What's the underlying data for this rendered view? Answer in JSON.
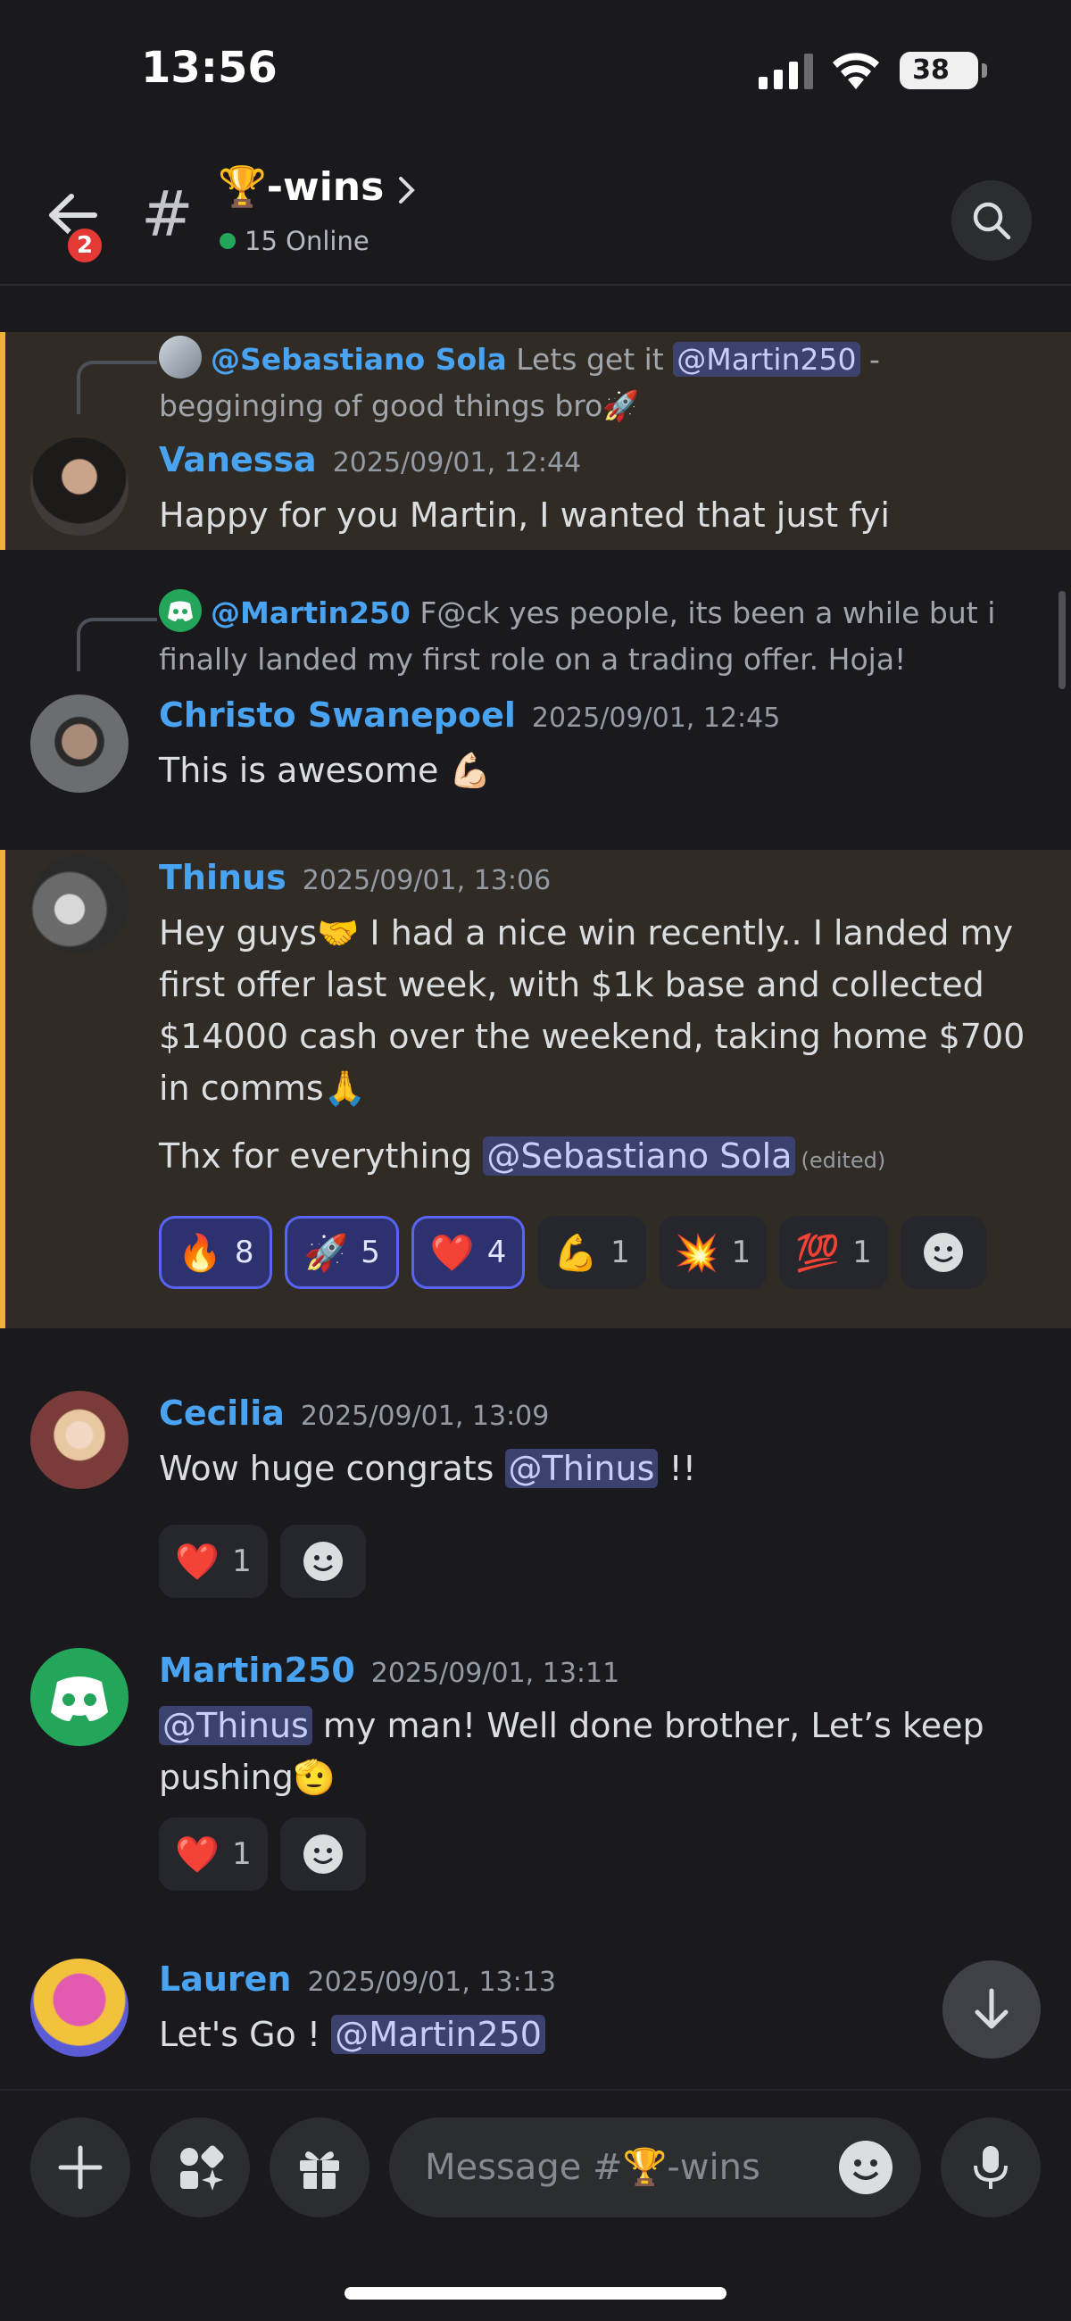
{
  "status_bar": {
    "time": "13:56",
    "battery": "38"
  },
  "header": {
    "back_badge": "2",
    "channel_name": "🏆-wins",
    "online": "15 Online"
  },
  "messages": [
    {
      "reply": {
        "author": "@Sebastiano Sola",
        "text_a": "Lets get it ",
        "mention": "@Martin250",
        "text_b": " - begginging of good things bro🚀"
      },
      "author": "Vanessa",
      "timestamp": "2025/09/01, 12:44",
      "text": "Happy for you Martin, I wanted that just fyi"
    },
    {
      "reply": {
        "author": "@Martin250",
        "text": "F@ck yes people, its been a while but i finally landed my first role on a trading offer. Hoja!"
      },
      "author": "Christo Swanepoel",
      "timestamp": "2025/09/01, 12:45",
      "text": "This is awesome 💪🏻"
    },
    {
      "author": "Thinus",
      "timestamp": "2025/09/01, 13:06",
      "text": "Hey guys🤝 I had a nice win recently.. I landed my first offer last week, with $1k base and collected $14000 cash over the weekend, taking home $700 in comms🙏",
      "text2": "Thx for everything ",
      "mention": "@Sebastiano Sola",
      "edited": "(edited)",
      "reactions": [
        {
          "emoji": "🔥",
          "count": "8"
        },
        {
          "emoji": "🚀",
          "count": "5"
        },
        {
          "emoji": "❤️",
          "count": "4"
        },
        {
          "emoji": "💪",
          "count": "1"
        },
        {
          "emoji": "💥",
          "count": "1"
        },
        {
          "emoji": "💯",
          "count": "1"
        }
      ]
    },
    {
      "author": "Cecilia",
      "timestamp": "2025/09/01, 13:09",
      "text_a": "Wow huge congrats ",
      "mention": "@Thinus",
      "text_b": " !!",
      "reactions": [
        {
          "emoji": "❤️",
          "count": "1"
        }
      ]
    },
    {
      "author": "Martin250",
      "timestamp": "2025/09/01, 13:11",
      "mention": "@Thinus",
      "text": " my man! Well done brother, Let’s keep pushing🫡",
      "reactions": [
        {
          "emoji": "❤️",
          "count": "1"
        }
      ]
    },
    {
      "author": "Lauren",
      "timestamp": "2025/09/01, 13:13",
      "text": "Let's Go ! ",
      "mention": "@Martin250"
    }
  ],
  "composer": {
    "placeholder": "Message #🏆-wins"
  },
  "colors": {
    "accent": "#5865f2",
    "highlight": "#f0b232",
    "name": "#4aa3f0",
    "online": "#23a55a"
  }
}
